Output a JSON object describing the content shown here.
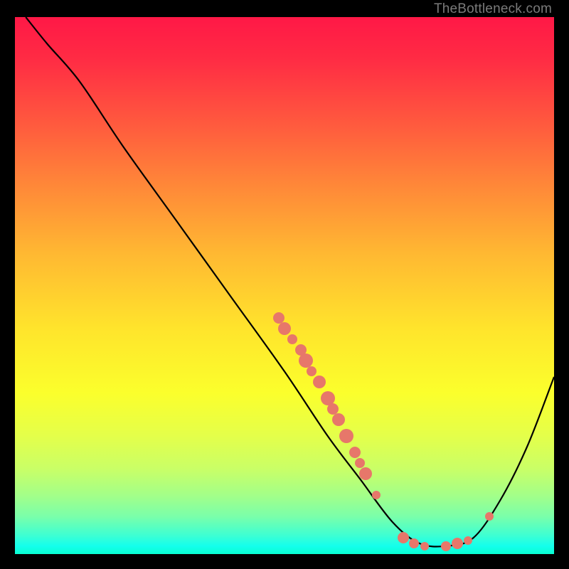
{
  "watermark": "TheBottleneck.com",
  "chart_data": {
    "type": "line",
    "title": "",
    "xlabel": "",
    "ylabel": "",
    "xlim": [
      0,
      100
    ],
    "ylim": [
      0,
      100
    ],
    "curve": [
      {
        "x": 2,
        "y": 100
      },
      {
        "x": 6,
        "y": 95
      },
      {
        "x": 12,
        "y": 88
      },
      {
        "x": 20,
        "y": 76
      },
      {
        "x": 30,
        "y": 62
      },
      {
        "x": 40,
        "y": 48
      },
      {
        "x": 50,
        "y": 34
      },
      {
        "x": 58,
        "y": 22
      },
      {
        "x": 64,
        "y": 14
      },
      {
        "x": 70,
        "y": 6
      },
      {
        "x": 75,
        "y": 2
      },
      {
        "x": 80,
        "y": 1.5
      },
      {
        "x": 85,
        "y": 3
      },
      {
        "x": 90,
        "y": 10
      },
      {
        "x": 95,
        "y": 20
      },
      {
        "x": 100,
        "y": 33
      }
    ],
    "scatter_points": [
      {
        "x": 49,
        "y": 44,
        "size": 16
      },
      {
        "x": 50,
        "y": 42,
        "size": 18
      },
      {
        "x": 51.5,
        "y": 40,
        "size": 14
      },
      {
        "x": 53,
        "y": 38,
        "size": 16
      },
      {
        "x": 54,
        "y": 36,
        "size": 20
      },
      {
        "x": 55,
        "y": 34,
        "size": 14
      },
      {
        "x": 56.5,
        "y": 32,
        "size": 18
      },
      {
        "x": 58,
        "y": 29,
        "size": 20
      },
      {
        "x": 59,
        "y": 27,
        "size": 16
      },
      {
        "x": 60,
        "y": 25,
        "size": 18
      },
      {
        "x": 61.5,
        "y": 22,
        "size": 20
      },
      {
        "x": 63,
        "y": 19,
        "size": 16
      },
      {
        "x": 64,
        "y": 17,
        "size": 14
      },
      {
        "x": 65,
        "y": 15,
        "size": 18
      },
      {
        "x": 67,
        "y": 11,
        "size": 12
      },
      {
        "x": 72,
        "y": 3,
        "size": 16
      },
      {
        "x": 74,
        "y": 2,
        "size": 14
      },
      {
        "x": 76,
        "y": 1.5,
        "size": 12
      },
      {
        "x": 80,
        "y": 1.5,
        "size": 14
      },
      {
        "x": 82,
        "y": 2,
        "size": 16
      },
      {
        "x": 84,
        "y": 2.5,
        "size": 12
      },
      {
        "x": 88,
        "y": 7,
        "size": 12
      }
    ],
    "gradient_bands": [
      "#ff1846",
      "#ff5a3e",
      "#ffb832",
      "#fbff2c",
      "#caff66",
      "#3effd2"
    ]
  }
}
